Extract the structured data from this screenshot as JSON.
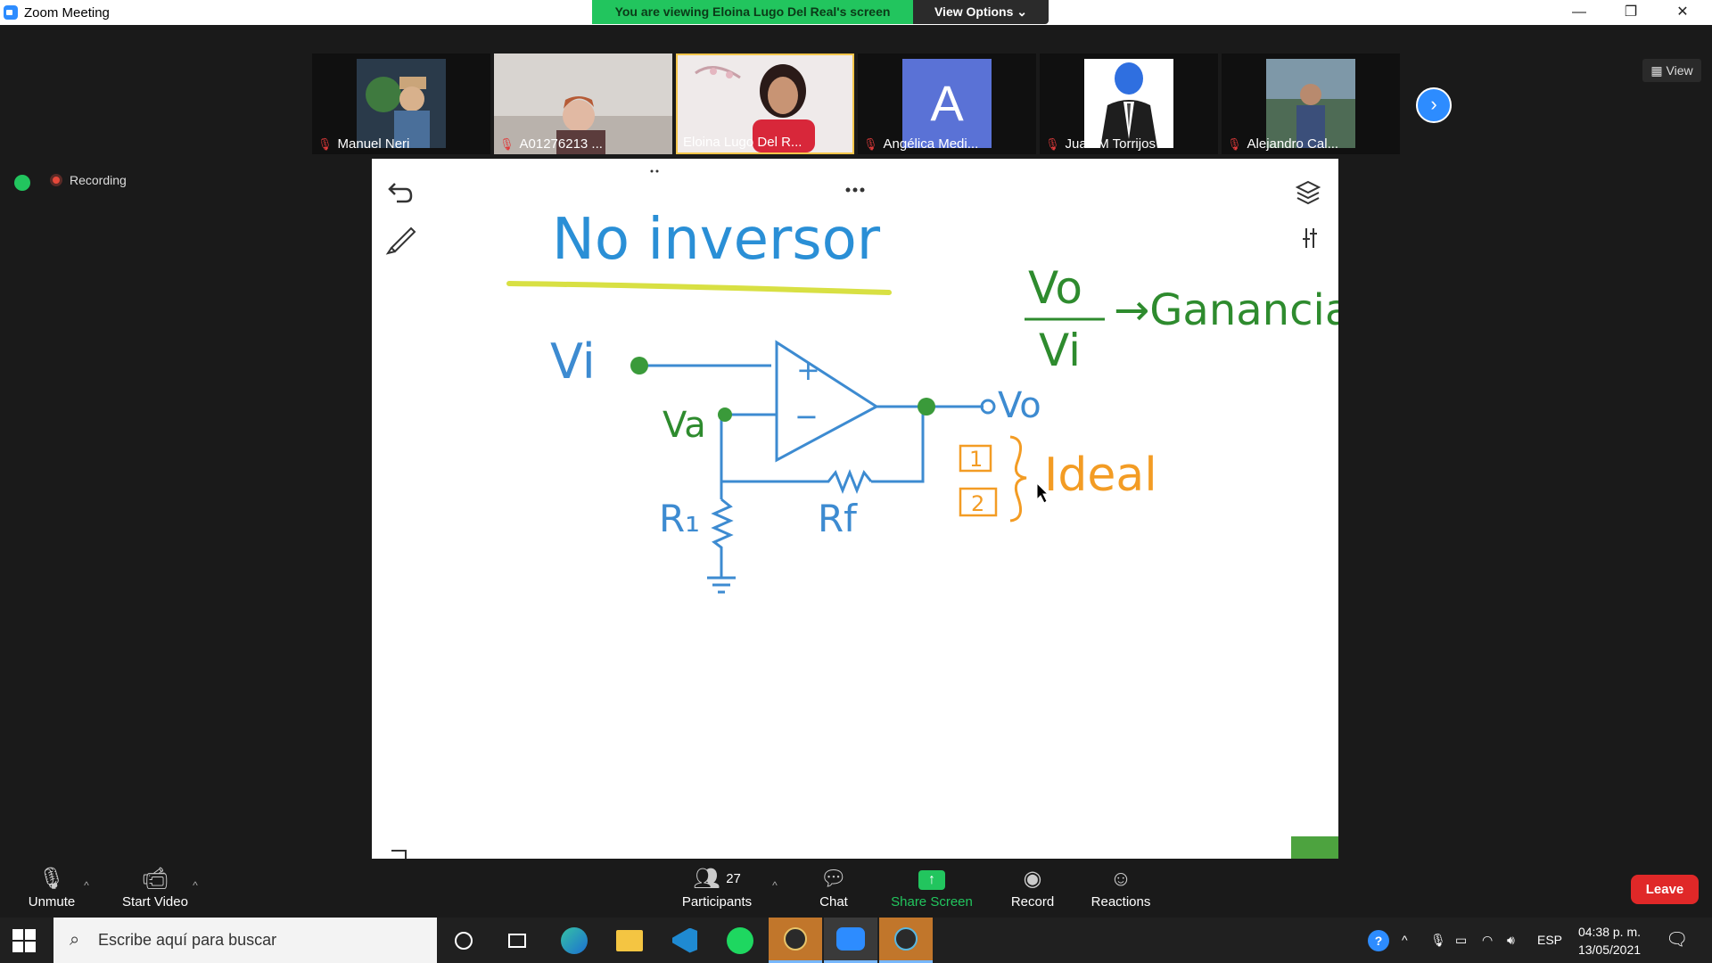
{
  "window": {
    "title": "Zoom Meeting",
    "viewing_banner": "You are viewing Eloina Lugo Del Real's screen",
    "view_options": "View Options ⌄",
    "minimize": "—",
    "maximize": "❐",
    "close": "✕"
  },
  "gallery": {
    "participants": [
      {
        "name": "Manuel Neri",
        "muted": true
      },
      {
        "name": "A01276213 ...",
        "muted": true
      },
      {
        "name": "Eloina Lugo Del R...",
        "muted": false
      },
      {
        "name": "Angélica Medi...",
        "muted": true,
        "avatar_letter": "A"
      },
      {
        "name": "Juan M Torrijos",
        "muted": true
      },
      {
        "name": "Alejandro Cal...",
        "muted": true
      }
    ],
    "view_label": "View"
  },
  "status": {
    "recording_label": "Recording"
  },
  "whiteboard": {
    "title": "No inversor",
    "labels": {
      "vi": "Vi",
      "va": "Va",
      "vo": "Vo",
      "r1": "R₁",
      "rf": "Rf",
      "plus": "+",
      "minus": "−",
      "box1": "1",
      "box2": "2",
      "ideal": "Ideal",
      "ratio_top": "Vo",
      "ratio_bottom": "Vi",
      "ganancia": "→Ganancia"
    },
    "colors": {
      "title": "#2a8fd6",
      "underline": "#d8e043",
      "circuit": "#3d8bd1",
      "node": "#3a9a3a",
      "green_text": "#2e8b2e",
      "orange": "#f39c24",
      "corner_block": "#4da33f"
    }
  },
  "toolbar": {
    "unmute": "Unmute",
    "start_video": "Start Video",
    "participants": "Participants",
    "participants_count": "27",
    "chat": "Chat",
    "share_screen": "Share Screen",
    "record": "Record",
    "reactions": "Reactions",
    "leave": "Leave"
  },
  "taskbar": {
    "search_placeholder": "Escribe aquí para buscar",
    "language": "ESP",
    "time": "04:38 p. m.",
    "date": "13/05/2021"
  }
}
